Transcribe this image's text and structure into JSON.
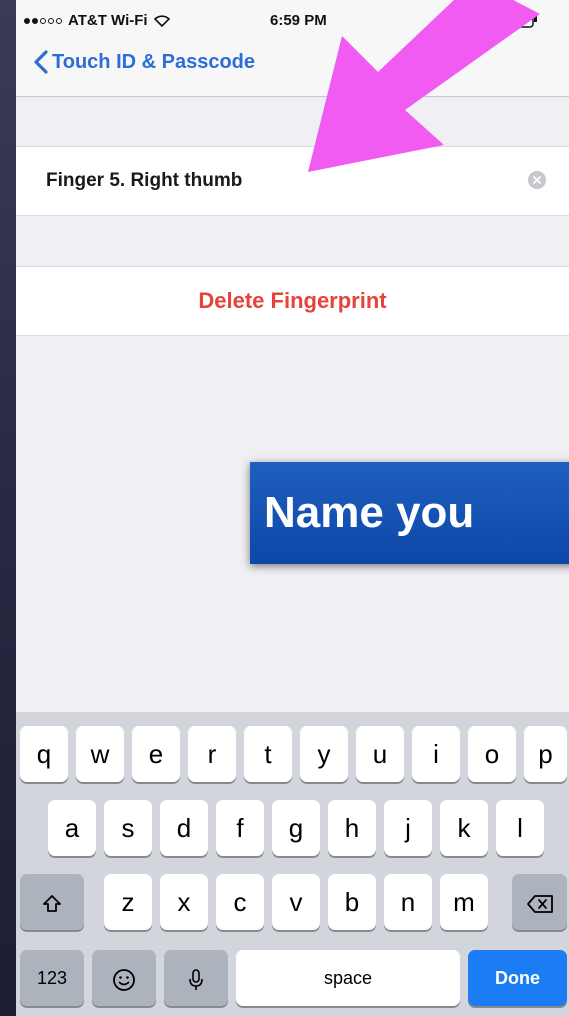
{
  "status_bar": {
    "carrier": "AT&T Wi-Fi",
    "time": "6:59 PM"
  },
  "nav": {
    "back_label": "Touch ID & Passcode",
    "accent_color": "#2d6dd8"
  },
  "fingerprint_name": {
    "value": "Finger 5. Right thumb"
  },
  "delete_button": {
    "label": "Delete Fingerprint",
    "color": "#e5443b"
  },
  "overlay": {
    "banner_text": "Name you",
    "arrow_color": "#f25bf2"
  },
  "keyboard": {
    "row1": [
      "q",
      "w",
      "e",
      "r",
      "t",
      "y",
      "u",
      "i",
      "o",
      "p"
    ],
    "row2": [
      "a",
      "s",
      "d",
      "f",
      "g",
      "h",
      "j",
      "k",
      "l"
    ],
    "row3": [
      "z",
      "x",
      "c",
      "v",
      "b",
      "n",
      "m"
    ],
    "numbers_label": "123",
    "space_label": "space",
    "done_label": "Done",
    "icons": [
      "shift-icon",
      "backspace-icon",
      "emoji-icon",
      "microphone-icon"
    ]
  }
}
